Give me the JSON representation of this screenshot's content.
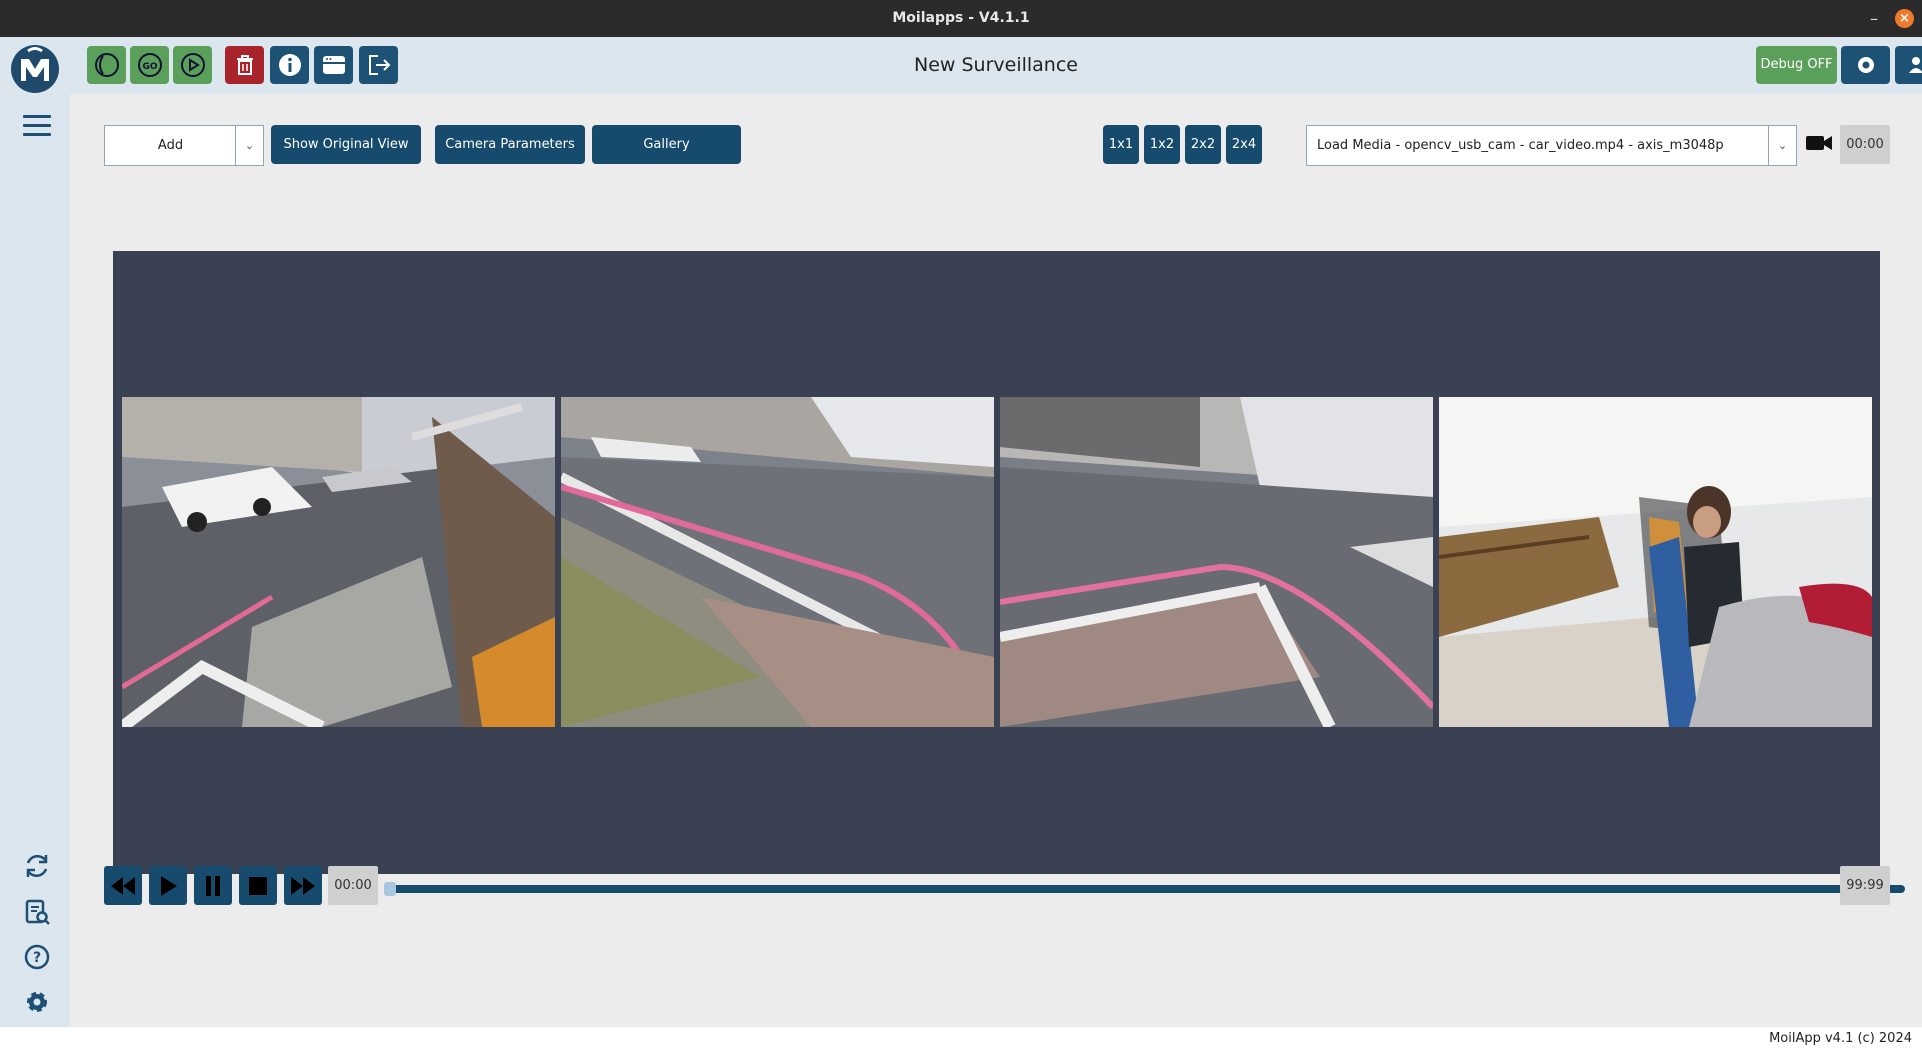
{
  "window": {
    "title": "Moilapps - V4.1.1"
  },
  "header": {
    "page_title": "New Surveillance",
    "debug_label": "Debug OFF"
  },
  "toolbar_icons": [
    "moil-circle-icon",
    "go-icon",
    "play-circle-icon",
    "trash-icon",
    "info-icon",
    "window-icon",
    "exit-icon"
  ],
  "content": {
    "add_label": "Add",
    "show_original_label": "Show Original View",
    "camera_params_label": "Camera Parameters",
    "gallery_label": "Gallery",
    "layouts": [
      "1x1",
      "1x2",
      "2x2",
      "2x4"
    ],
    "media_select": "Load Media - opencv_usb_cam - car_video.mp4 - axis_m3048p",
    "top_time": "00:00"
  },
  "player": {
    "current_time": "00:00",
    "end_time": "99:99",
    "progress": 0.0
  },
  "footer": {
    "text": "MoilApp v4.1 (c) 2024"
  },
  "colors": {
    "accent": "#174b6e",
    "green": "#5a9f5a",
    "red": "#a8232a",
    "viewer_bg": "#3a4152"
  }
}
